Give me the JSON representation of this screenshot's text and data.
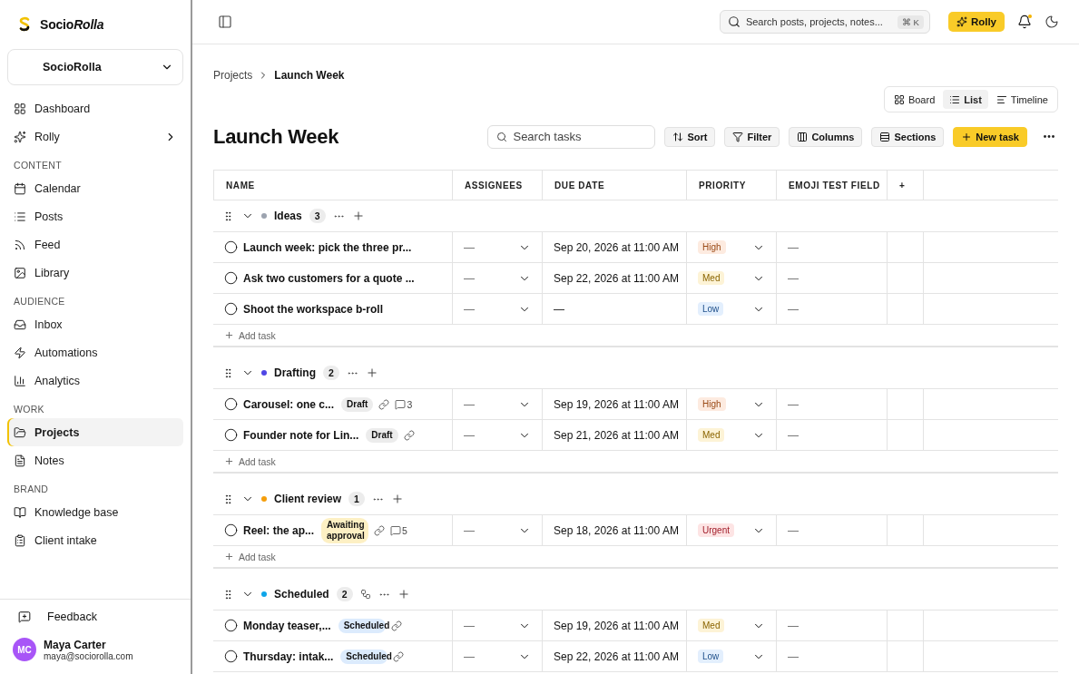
{
  "brand": {
    "name_plain": "Socio",
    "name_italic": "Rolla"
  },
  "workspace": {
    "name": "SocioRolla"
  },
  "nav": [
    {
      "items": [
        {
          "label": "Dashboard",
          "selected": false,
          "expandable": false
        },
        {
          "label": "Rolly",
          "selected": false,
          "expandable": true
        }
      ]
    },
    {
      "heading": "CONTENT",
      "items": [
        {
          "label": "Calendar",
          "selected": false,
          "expandable": false
        },
        {
          "label": "Posts",
          "selected": false,
          "expandable": false
        },
        {
          "label": "Feed",
          "selected": false,
          "expandable": false
        },
        {
          "label": "Library",
          "selected": false,
          "expandable": false
        }
      ]
    },
    {
      "heading": "AUDIENCE",
      "items": [
        {
          "label": "Inbox",
          "selected": false,
          "expandable": false
        },
        {
          "label": "Automations",
          "selected": false,
          "expandable": false
        },
        {
          "label": "Analytics",
          "selected": false,
          "expandable": false
        }
      ]
    },
    {
      "heading": "WORK",
      "items": [
        {
          "label": "Projects",
          "selected": true,
          "expandable": false
        },
        {
          "label": "Notes",
          "selected": false,
          "expandable": false
        }
      ]
    },
    {
      "heading": "BRAND",
      "items": [
        {
          "label": "Knowledge base",
          "selected": false,
          "expandable": false
        },
        {
          "label": "Client intake",
          "selected": false,
          "expandable": false
        }
      ]
    }
  ],
  "feedback": "Feedback",
  "user": {
    "initials": "MC",
    "name": "Maya Carter",
    "email": "maya@sociorolla.com"
  },
  "topbar": {
    "search_placeholder": "Search posts, projects, notes...",
    "shortcut": "⌘ K",
    "assistant": "Rolly",
    "notification_dot": true
  },
  "breadcrumb": [
    {
      "label": "Projects",
      "current": false
    },
    {
      "label": "Launch Week",
      "current": true
    }
  ],
  "views": [
    {
      "label": "Board",
      "selected": false
    },
    {
      "label": "List",
      "selected": true
    },
    {
      "label": "Timeline",
      "selected": false
    }
  ],
  "title": "Launch Week",
  "task_search": {
    "placeholder": "Search tasks"
  },
  "actions": [
    {
      "label": "Sort",
      "kind": "default"
    },
    {
      "label": "Filter",
      "kind": "default"
    },
    {
      "label": "Columns",
      "kind": "default"
    },
    {
      "label": "Sections",
      "kind": "default"
    },
    {
      "label": "New task",
      "kind": "primary"
    }
  ],
  "columns": [
    "NAME",
    "ASSIGNEES",
    "DUE DATE",
    "PRIORITY",
    "EMOJI TEST FIELD",
    "+"
  ],
  "sections": [
    {
      "name": "Ideas",
      "color": "#9ca3af",
      "count": "3",
      "linked": false,
      "add_task": "Add task",
      "tasks": [
        {
          "name": "Launch week: pick the three pr...",
          "done": false,
          "link": false,
          "assignee": "—",
          "due": "Sep 20, 2026 at 11:00 AM",
          "priority": {
            "label": "High",
            "color": "#fdebe0"
          },
          "emoji": "—"
        },
        {
          "name": "Ask two customers for a quote ...",
          "done": false,
          "link": false,
          "assignee": "—",
          "due": "Sep 22, 2026 at 11:00 AM",
          "priority": {
            "label": "Med",
            "color": "#fdf3d6"
          },
          "emoji": "—"
        },
        {
          "name": "Shoot the workspace b-roll",
          "done": false,
          "link": false,
          "assignee": "—",
          "due": "—",
          "priority": {
            "label": "Low",
            "color": "#e3effd"
          },
          "emoji": "—"
        }
      ]
    },
    {
      "name": "Drafting",
      "color": "#4f46e5",
      "count": "2",
      "linked": false,
      "add_task": "Add task",
      "tasks": [
        {
          "name": "Carousel: one c...",
          "done": false,
          "tag": {
            "label": "Draft",
            "color": "#ececec"
          },
          "link": true,
          "comments": "3",
          "assignee": "—",
          "due": "Sep 19, 2026 at 11:00 AM",
          "priority": {
            "label": "High",
            "color": "#fdebe0"
          },
          "emoji": "—"
        },
        {
          "name": "Founder note for Lin...",
          "done": false,
          "tag": {
            "label": "Draft",
            "color": "#ececec"
          },
          "link": true,
          "assignee": "—",
          "due": "Sep 21, 2026 at 11:00 AM",
          "priority": {
            "label": "Med",
            "color": "#fdf3d6"
          },
          "emoji": "—"
        }
      ]
    },
    {
      "name": "Client review",
      "color": "#f59e0b",
      "count": "1",
      "linked": false,
      "add_task": "Add task",
      "tasks": [
        {
          "name": "Reel: the ap...",
          "done": false,
          "tag": {
            "label": "Awaiting approval",
            "color": "#fdf0c4"
          },
          "link": true,
          "comments": "5",
          "assignee": "—",
          "due": "Sep 18, 2026 at 11:00 AM",
          "priority": {
            "label": "Urgent",
            "color": "#fde4e4"
          },
          "emoji": "—"
        }
      ]
    },
    {
      "name": "Scheduled",
      "color": "#0ea5e9",
      "count": "2",
      "linked": true,
      "tasks": [
        {
          "name": "Monday teaser,...",
          "done": false,
          "tag": {
            "label": "Scheduled",
            "color": "#dcebfd"
          },
          "link": true,
          "assignee": "—",
          "due": "Sep 19, 2026 at 11:00 AM",
          "priority": {
            "label": "Med",
            "color": "#fdf3d6"
          },
          "emoji": "—"
        },
        {
          "name": "Thursday: intak...",
          "done": false,
          "tag": {
            "label": "Scheduled",
            "color": "#dcebfd"
          },
          "link": true,
          "assignee": "—",
          "due": "Sep 22, 2026 at 11:00 AM",
          "priority": {
            "label": "Low",
            "color": "#e3effd"
          },
          "emoji": "—"
        }
      ]
    }
  ]
}
